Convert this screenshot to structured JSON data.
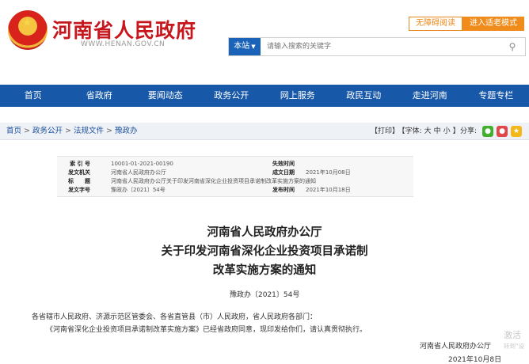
{
  "header": {
    "site_title": "河南省人民政府",
    "site_domain": "WWW.HENAN.GOV.CN",
    "accessible_label": "无障碍阅读",
    "elder_mode_label": "进入适老模式",
    "search_scope": "本站",
    "search_placeholder": "请输入搜索的关键字"
  },
  "nav": {
    "items": [
      "首页",
      "省政府",
      "要闻动态",
      "政务公开",
      "网上服务",
      "政民互动",
      "走进河南",
      "专题专栏"
    ]
  },
  "breadcrumb": {
    "items": [
      "首页",
      "政务公开",
      "法规文件",
      "豫政办"
    ],
    "separator": ">"
  },
  "tools": {
    "print": "【打印】",
    "font_label": "【字体:",
    "font_large": "大",
    "font_medium": "中",
    "font_small": "小",
    "font_end": "】",
    "share_label": "分享:"
  },
  "meta": {
    "index_label": "索 引 号",
    "index_value": "10001-01-2021-00190",
    "expiry_label": "失效时间",
    "expiry_value": "",
    "issuer_label": "发文机关",
    "issuer_value": "河南省人民政府办公厅",
    "date_label": "成文日期",
    "date_value": "2021年10月08日",
    "title_label": "标　　题",
    "title_value": "河南省人民政府办公厅关于印发河南省深化企业投资项目承诺制改革实施方案的通知",
    "number_label": "发文字号",
    "number_value": "豫政办〔2021〕54号",
    "publish_label": "发布时间",
    "publish_value": "2021年10月18日"
  },
  "document": {
    "title_line1": "河南省人民政府办公厅",
    "title_line2": "关于印发河南省深化企业投资项目承诺制",
    "title_line3": "改革实施方案的通知",
    "doc_number": "豫政办〔2021〕54号",
    "recipients": "各省辖市人民政府、济源示范区管委会、各省直管县（市）人民政府，省人民政府各部门：",
    "body": "《河南省深化企业投资项目承诺制改革实施方案》已经省政府同意，现印发给你们，请认真贯彻执行。",
    "signature": "河南省人民政府办公厅",
    "sign_date": "2021年10月8日"
  },
  "watermark": {
    "line1": "激活",
    "line2": "转到\"设"
  },
  "colors": {
    "brand_red": "#c8161d",
    "nav_blue": "#1858a9",
    "accent_orange": "#ef8c1c"
  }
}
